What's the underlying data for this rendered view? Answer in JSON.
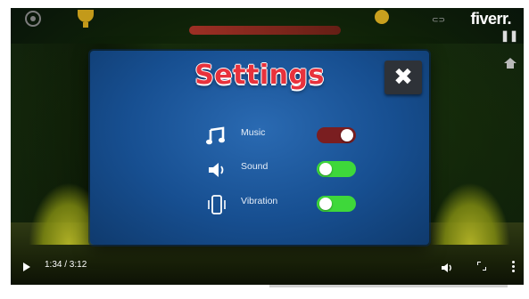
{
  "video": {
    "watermark": "fiverr.",
    "time_display": "1:34 / 3:12",
    "progress_fraction": 0.51
  },
  "settings": {
    "title": "Settings",
    "close_label": "✖",
    "items": [
      {
        "label": "Music",
        "icon": "music-note-icon",
        "state": "on"
      },
      {
        "label": "Sound",
        "icon": "speaker-icon",
        "state": "off"
      },
      {
        "label": "Vibration",
        "icon": "vibration-icon",
        "state": "off"
      }
    ]
  },
  "colors": {
    "toggle_on": "#7a1e20",
    "toggle_off": "#3ed83a",
    "title_red": "#e8323c",
    "panel_blue": "#174f91"
  }
}
